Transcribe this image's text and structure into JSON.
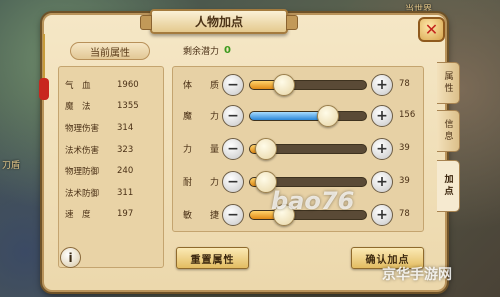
{
  "window": {
    "title": "人物加点"
  },
  "background": {
    "label_top": "当世界",
    "label_left": "刀盾"
  },
  "left_panel": {
    "header": "当前属性",
    "attributes": [
      {
        "name": "气　血",
        "value": "1960"
      },
      {
        "name": "魔　法",
        "value": "1355"
      },
      {
        "name": "物理伤害",
        "value": "314"
      },
      {
        "name": "法术伤害",
        "value": "323"
      },
      {
        "name": "物理防御",
        "value": "240"
      },
      {
        "name": "法术防御",
        "value": "311"
      },
      {
        "name": "速　度",
        "value": "197"
      }
    ]
  },
  "potential": {
    "label": "剩余潜力",
    "value": "0"
  },
  "stats": [
    {
      "c1": "体",
      "c2": "质",
      "value": "78",
      "fill": 0.22,
      "color": "orange"
    },
    {
      "c1": "魔",
      "c2": "力",
      "value": "156",
      "fill": 0.6,
      "color": "blue"
    },
    {
      "c1": "力",
      "c2": "量",
      "value": "39",
      "fill": 0.07,
      "color": "orange"
    },
    {
      "c1": "耐",
      "c2": "力",
      "value": "39",
      "fill": 0.07,
      "color": "orange"
    },
    {
      "c1": "敏",
      "c2": "捷",
      "value": "78",
      "fill": 0.22,
      "color": "orange"
    }
  ],
  "buttons": {
    "reset": "重置属性",
    "confirm": "确认加点",
    "info": "i",
    "close": "✕",
    "minus": "−",
    "plus": "+"
  },
  "tabs": [
    {
      "label": "属性",
      "active": false
    },
    {
      "label": "信息",
      "active": false
    },
    {
      "label": "加点",
      "active": true
    }
  ],
  "watermark": {
    "site": "bao76",
    "cn": "京华手游网"
  },
  "colors": {
    "fill_orange": "#e08a16",
    "fill_blue": "#2a86d8",
    "potential": "#3c9a1e"
  }
}
